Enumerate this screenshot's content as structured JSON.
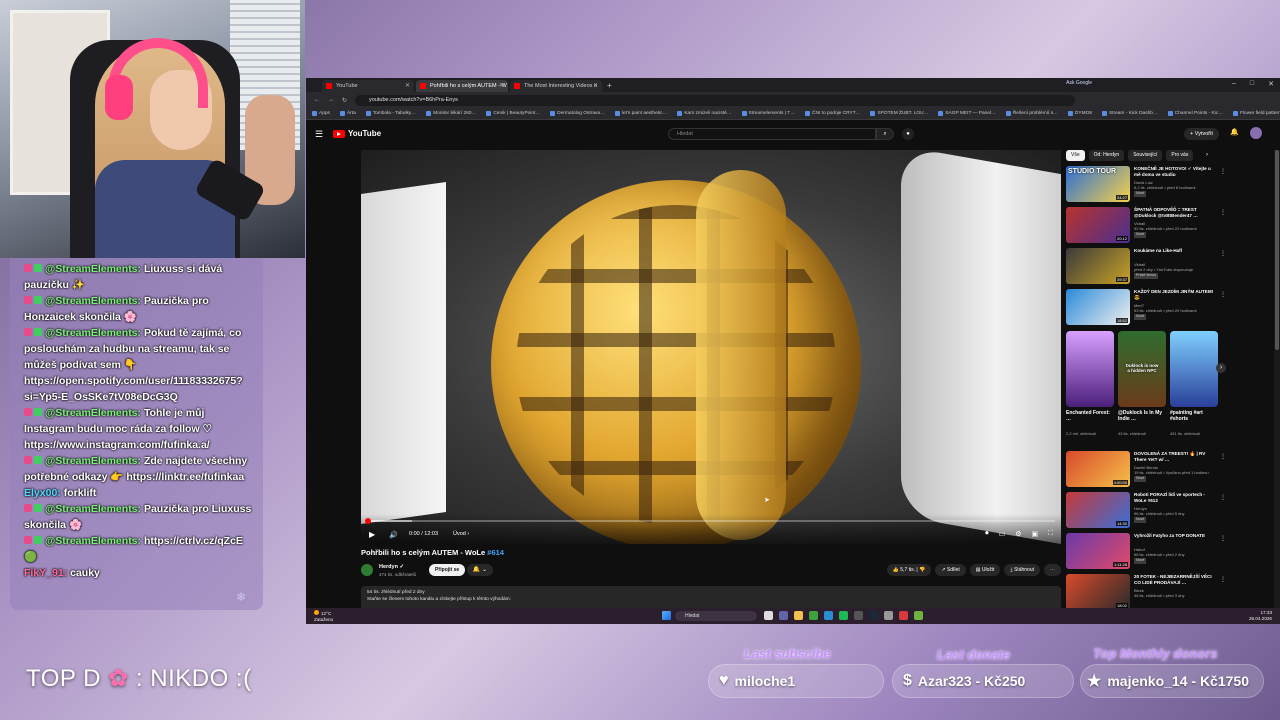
{
  "chat": [
    {
      "user": "@StreamElements:",
      "text": "Liuxuss si dává pauzičku ✨"
    },
    {
      "user": "@StreamElements:",
      "text": "Pauzička pro Honzaicek skončila 🌸"
    },
    {
      "user": "@StreamElements:",
      "text": "Pokud tě zajímá, co poslouchám za hudbu na streamu, tak se můžeš podívat sem 👇 https://open.spotify.com/user/11183332675?si=Yp5-E_OsSKe7tV08eDcG3Q"
    },
    {
      "user": "@StreamElements:",
      "text": "Tohle je můj Instagram budu moc ráda za follow ♡ https://www.instagram.com/fufinka.a/"
    },
    {
      "user": "@StreamElements:",
      "text": "Zde najdete všechny potřebné odkazy 👉 https://linktr.ee/fufinkaa"
    },
    {
      "user": "Elyx00:",
      "text": "forklift",
      "style": "u2"
    },
    {
      "user": "@StreamElements:",
      "text": "Pauzička pro Liuxuss skončila 🌸"
    },
    {
      "user": "@StreamElements:",
      "text": "https://ctrlv.cz/qZcE 🟢"
    },
    {
      "user": "FikY_91:",
      "text": "cauky",
      "style": "u3"
    }
  ],
  "overlay": {
    "top_d_prefix": "TOP D",
    "top_d_suffix": ": NIKDO :(",
    "last_subscribe_label": "Last subscibe",
    "last_subscribe_value": "miloche1",
    "last_donate_label": "Last donate",
    "last_donate_value": "Azar323 - Kč250",
    "top_donors_label": "Top Monthly donors",
    "top_donors_value": "majenko_14 - Kč1750"
  },
  "browser": {
    "tabs": [
      {
        "title": "YouTube",
        "active": false
      },
      {
        "title": "Pohřbili ho s celým AUTEM - W",
        "active": true
      },
      {
        "title": "The Most Interesting Videos o",
        "active": false
      }
    ],
    "url": "youtube.com/watch?v=B6hPra-Enys",
    "ask_google": "Ask Google",
    "bookmarks": [
      "Apps",
      "Árta",
      "Tomboła - Tabulky…",
      "Monitor lékárí 260…",
      "Cenik | BeautyPoint…",
      "Dermatolog Ostrava…",
      "let's paint aesthetic…",
      "Kam zmizeli nacisté…",
      "Streamelements | T…",
      "ČNI to podoje CRYT…",
      "SPOTEM ŽUBT. LOU…",
      "SAGP MEIT — Panel…",
      "Řešení problémů s…",
      "DYMO8",
      "Stream - Kick Dashb…",
      "Channel Points - Kic…",
      "Flower field pattern…"
    ]
  },
  "youtube": {
    "logo": "YouTube",
    "search_placeholder": "Hledat",
    "create_label": "Vytvořit",
    "video": {
      "time": "0:00 / 12:03",
      "chapter": "Úvod",
      "title": "Pohřbili ho s celým AUTEM - WoLe",
      "episode": "#614",
      "channel": "Herdyn",
      "subs": "474 tis. odběratelů",
      "join": "Připojit se",
      "likes": "5,7 tis.",
      "share": "Sdílet",
      "save": "Uložit",
      "download": "Stáhnout",
      "views": "54 tis. zhlédnutí  před 2 dny",
      "desc": "Staňte se členem tohoto kanálu a získejte přístup k těmto výhodám:"
    },
    "chips": [
      "Vše",
      "Od: Herdyn",
      "Související",
      "Pro vás"
    ],
    "recs": [
      {
        "title": "KONEČNĚ JE HOTOVO! ✓ Vítejte u mě doma ve studiu",
        "channel": "David Lutz",
        "meta": "6,2 tis. zhlédnutí • před 8 hodinami",
        "badge": "Nové",
        "dur": "34:27",
        "thumb": "STUDIO TOUR"
      },
      {
        "title": "ŠPATNÁ ODPOVĚĎ = TREST @Duklock @tvBtBender47 …",
        "channel": "Vidrail",
        "meta": "92 tis. zhlédnutí • před 22 hodinami",
        "badge": "Nové",
        "dur": "20:12",
        "thumb": ""
      },
      {
        "title": "Koukáme na Like-Hafl",
        "channel": "Vidrail",
        "meta": "před 2 dny • YouTube doporučuje",
        "badge": "Právě ženou",
        "dur": "39:37",
        "thumb": ""
      },
      {
        "title": "KAŽDÝ DEN JEZDÍM JINÝM AUTEM! 😎",
        "channel": "MenT",
        "meta": "53 tis. zhlédnutí • před 20 hodinami",
        "badge": "Nové",
        "dur": "18:52",
        "thumb": ""
      }
    ],
    "shorts": [
      {
        "title": "Enchanted Forest: …",
        "meta": "2,2 mil. zhlédnutí"
      },
      {
        "title": "@Duklock Is In My Indie …",
        "meta": "43 tis. zhlédnutí"
      },
      {
        "title": "#painting #art #shorts",
        "meta": "451 tis. zhlédnutí"
      }
    ],
    "short_overlay": "Duklock is now a hidden NPC",
    "recs2": [
      {
        "title": "DOVOLENÁ ZA TREEST! 🔥 | RV There Yet? w/ …",
        "channel": "Daniel Bendu",
        "meta": "19 tis. zhlédnutí • Vysíláno před 1 hodinou",
        "badge": "Nové",
        "dur": "4:00:55"
      },
      {
        "title": "Roboti PORAZÍ lidi ve sportech - WoLe #612",
        "channel": "Herdyn",
        "meta": "96 tis. zhlédnutí • před 5 dny",
        "badge": "Nové",
        "dur": "14:30"
      },
      {
        "title": "Vyhrožil Fatyho za TOP DONATE",
        "channel": "Habof",
        "meta": "68 tis. zhlédnutí • před 2 dny",
        "badge": "Nové",
        "dur": "1:11:28"
      },
      {
        "title": "20 FOTEK - NEJBIZARRNĚJŠÍ VĚCI CO LIDÉ PRODÁVAJÍ …",
        "channel": "Blesk",
        "meta": "46 tis. zhlédnutí • před 3 dny",
        "badge": "",
        "dur": "18:02"
      }
    ]
  },
  "taskbar": {
    "weather_temp": "12°C",
    "weather_text": "Zataženo",
    "search": "Hledat",
    "time": "17:33",
    "date": "26.04.2026"
  }
}
